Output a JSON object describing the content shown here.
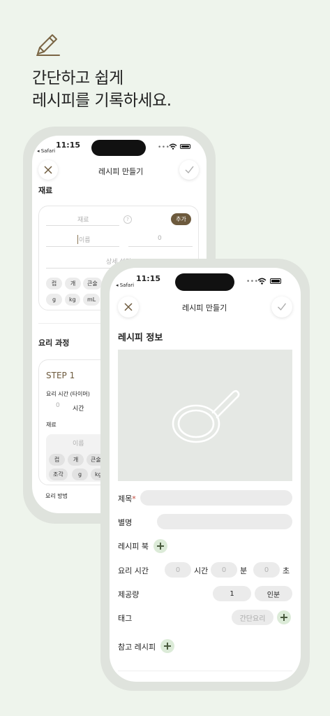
{
  "headline": {
    "line1": "간단하고 쉽게",
    "line2": "레시피를 기록하세요."
  },
  "status_bar": {
    "time": "11:15",
    "back_app": "◂ Safari",
    "signal": "••••"
  },
  "nav": {
    "title": "레시피 만들기"
  },
  "back_screen": {
    "ingredients_title": "재료",
    "ingredient_placeholder": "재료",
    "add_button": "추가",
    "name_placeholder": "이름",
    "amount_placeholder": "0",
    "detail_placeholder": "상세 설명",
    "unit_chips_row1": [
      "컵",
      "개",
      "큰술"
    ],
    "unit_chips_row2": [
      "g",
      "kg",
      "mL"
    ],
    "process_title": "요리 과정",
    "step_title": "STEP 1",
    "cook_time_label": "요리 시간 (타이머)",
    "time_value": "0",
    "time_unit": "시간",
    "step_ingredients_label": "재료",
    "step_name_placeholder": "이름",
    "step_chips_row1": [
      "컵",
      "개",
      "큰술"
    ],
    "step_chips_row2": [
      "조각",
      "g",
      "kg"
    ],
    "method_label": "요리 방법"
  },
  "front_screen": {
    "section_title": "레시피 정보",
    "title_label": "제목",
    "required_mark": "*",
    "alias_label": "별명",
    "recipe_book_label": "레시피 북",
    "cook_time_label": "요리 시간",
    "hours_value": "0",
    "hours_unit": "시간",
    "minutes_value": "0",
    "minutes_unit": "분",
    "seconds_value": "0",
    "seconds_unit": "초",
    "servings_label": "제공량",
    "servings_value": "1",
    "servings_unit": "인분",
    "tag_label": "태그",
    "tag_placeholder": "간단요리",
    "reference_label": "참고 레시피"
  },
  "colors": {
    "background": "#eef4ec",
    "accent_brown": "#6d5a3d",
    "plus_green": "#dcebd8",
    "required_red": "#c0483c"
  }
}
